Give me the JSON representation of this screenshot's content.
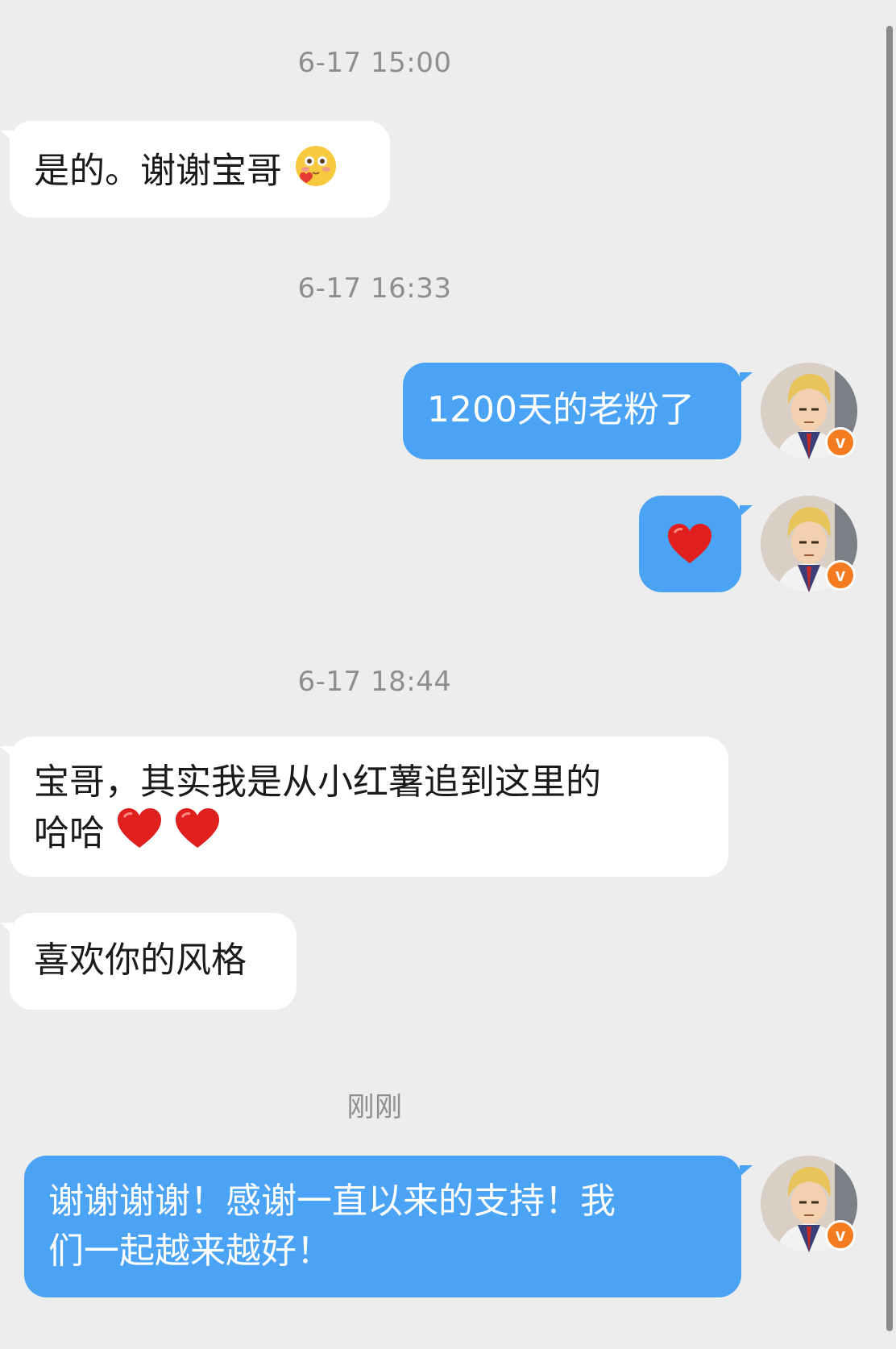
{
  "chat": {
    "timestamps": [
      "6-17 15:00",
      "6-17 16:33",
      "6-17 18:44",
      "刚刚"
    ],
    "messages": [
      {
        "side": "in",
        "text": "是的。谢谢宝哥",
        "emoji": "blushing-face-with-heart"
      },
      {
        "side": "out",
        "text": "1200天的老粉了"
      },
      {
        "side": "out",
        "text": "",
        "emoji": "red-heart"
      },
      {
        "side": "in",
        "text_line1": "宝哥，其实我是从小红薯追到这里的",
        "text_line2": "哈哈",
        "emoji": "red-heart x2"
      },
      {
        "side": "in",
        "text": "喜欢你的风格"
      },
      {
        "side": "out",
        "text_line1": "谢谢谢谢！感谢一直以来的支持！我",
        "text_line2": "们一起越来越好！"
      }
    ],
    "avatar_badge": "v",
    "avatar_icon": "user-avatar-anime-blond"
  },
  "colors": {
    "background": "#ededed",
    "incoming_bubble": "#ffffff",
    "outgoing_bubble": "#4aa3f4",
    "timestamp": "#8e8e8e",
    "badge": "#f57b20"
  }
}
